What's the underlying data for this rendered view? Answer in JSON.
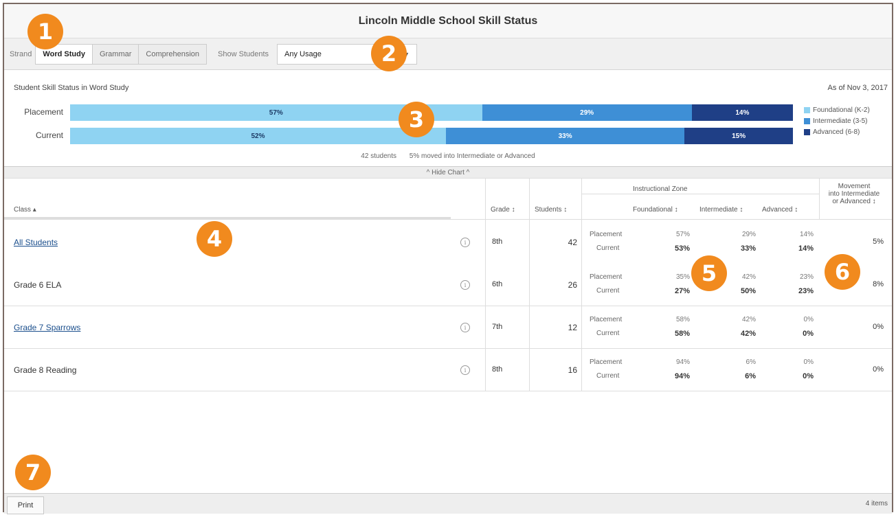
{
  "app": {
    "title": "Lincoln Middle School Skill Status"
  },
  "toolbar": {
    "strand_label": "Strand",
    "tabs": [
      {
        "label": "Word Study",
        "active": true
      },
      {
        "label": "Grammar",
        "active": false
      },
      {
        "label": "Comprehension",
        "active": false
      }
    ],
    "show_students_label": "Show Students",
    "show_students_value": "Any Usage"
  },
  "chart_data": {
    "type": "bar",
    "title": "Student Skill Status in Word Study",
    "as_of": "As of Nov 3, 2017",
    "categories": [
      "Placement",
      "Current"
    ],
    "series": [
      {
        "name": "Foundational (K-2)",
        "color": "#8fd3f2",
        "values": [
          57,
          52
        ]
      },
      {
        "name": "Intermediate (3-5)",
        "color": "#3e8fd6",
        "values": [
          29,
          33
        ]
      },
      {
        "name": "Advanced (6-8)",
        "color": "#1f3f86",
        "values": [
          14,
          15
        ]
      }
    ],
    "labels": [
      [
        "57%",
        "29%",
        "14%"
      ],
      [
        "52%",
        "33%",
        "15%"
      ]
    ],
    "stacked": true,
    "orientation": "horizontal",
    "legend": "right"
  },
  "summary": {
    "students": "42 students",
    "moved": "5% moved into Intermediate or Advanced"
  },
  "hide_chart_label": "^ Hide Chart ^",
  "table": {
    "headers": {
      "class": "Class ▴",
      "grade": "Grade ↕",
      "students": "Students ↕",
      "zone_group": "Instructional Zone",
      "foundational": "Foundational ↕",
      "intermediate": "Intermediate ↕",
      "advanced": "Advanced ↕",
      "movement_1": "Movement",
      "movement_2": "into Intermediate",
      "movement_3": "or Advanced ↕"
    },
    "placement_label": "Placement",
    "current_label": "Current",
    "rows": [
      {
        "name": "All Students",
        "grade": "8th",
        "students": "42",
        "placement": [
          "57%",
          "29%",
          "14%"
        ],
        "current": [
          "53%",
          "33%",
          "14%"
        ],
        "movement": "5%"
      },
      {
        "name": "Grade 6 ELA",
        "grade": "6th",
        "students": "26",
        "placement": [
          "35%",
          "42%",
          "23%"
        ],
        "current": [
          "27%",
          "50%",
          "23%"
        ],
        "movement": "8%"
      },
      {
        "name": "Grade 7 Sparrows",
        "grade": "7th",
        "students": "12",
        "placement": [
          "58%",
          "42%",
          "0%"
        ],
        "current": [
          "58%",
          "42%",
          "0%"
        ],
        "movement": "0%"
      },
      {
        "name": "Grade 8 Reading",
        "grade": "8th",
        "students": "16",
        "placement": [
          "94%",
          "6%",
          "0%"
        ],
        "current": [
          "94%",
          "6%",
          "0%"
        ],
        "movement": "0%"
      }
    ]
  },
  "footer": {
    "print_label": "Print",
    "items_count": "4 items"
  },
  "markers": [
    "1",
    "2",
    "3",
    "4",
    "5",
    "6",
    "7"
  ],
  "info_glyph": "i"
}
